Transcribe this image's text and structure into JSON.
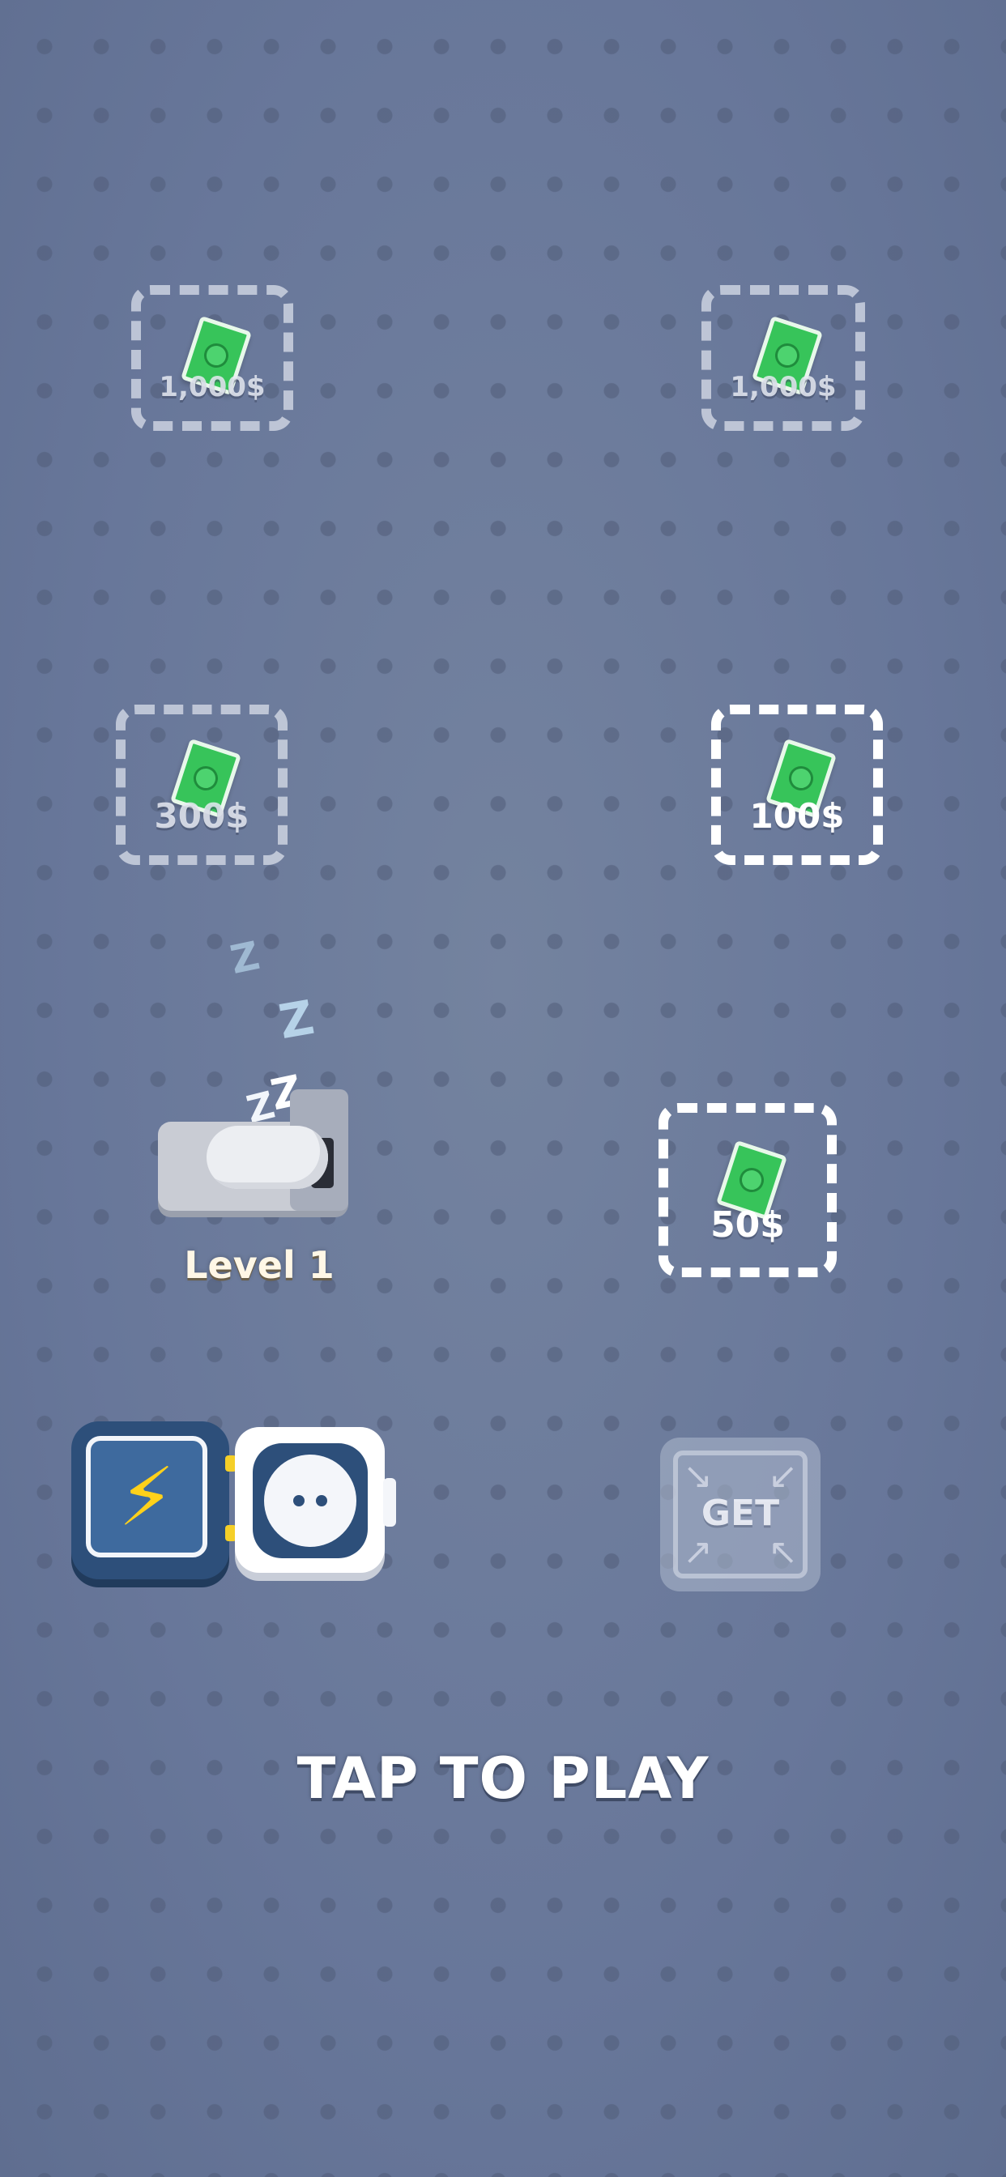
{
  "slots": [
    {
      "price": "1,000$",
      "state": "locked"
    },
    {
      "price": "1,000$",
      "state": "locked"
    },
    {
      "price": "300$",
      "state": "locked"
    },
    {
      "price": "100$",
      "state": "available"
    },
    {
      "price": "50$",
      "state": "available"
    }
  ],
  "sleep_symbol": "Z",
  "player": {
    "level_label": "Level 1"
  },
  "power": {
    "icon": "lightning-bolt-icon",
    "bolt": "⚡"
  },
  "socket": {
    "icon": "power-socket-icon"
  },
  "get_button": {
    "label": "GET",
    "icon": "expand-arrows-icon"
  },
  "prompt": "TAP TO PLAY",
  "colors": {
    "background": "#6b7a98",
    "bill": "#37c45a",
    "power_block": "#2d4f7a",
    "bolt": "#ffd11a"
  }
}
